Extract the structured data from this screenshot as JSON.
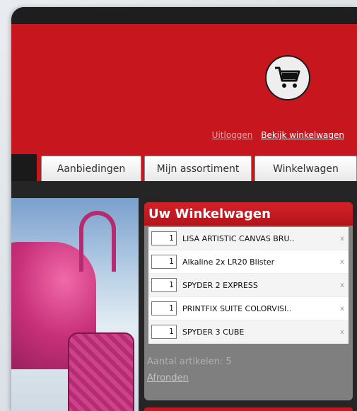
{
  "header": {
    "cart_icon": "shopping-cart-icon",
    "logout_label": "Uitloggen",
    "view_cart_label": "Bekijk winkelwagen"
  },
  "nav": {
    "tabs": [
      {
        "label": "Aanbiedingen"
      },
      {
        "label": "Mijn assortiment"
      },
      {
        "label": "Winkelwagen"
      }
    ]
  },
  "cart": {
    "title": "Uw Winkelwagen",
    "items": [
      {
        "qty": "1",
        "name": "LISA ARTISTIC CANVAS BRU..",
        "remove": "x"
      },
      {
        "qty": "1",
        "name": "Alkaline 2x LR20 Blister",
        "remove": "x"
      },
      {
        "qty": "1",
        "name": "SPYDER 2 EXPRESS",
        "remove": "x"
      },
      {
        "qty": "1",
        "name": "PRINTFIX SUITE COLORVISI..",
        "remove": "x"
      },
      {
        "qty": "1",
        "name": "SPYDER 3 CUBE",
        "remove": "x"
      }
    ],
    "count_label": "Aantal artikelen: 5",
    "finish_label": "Afronden"
  },
  "colors": {
    "brand_red": "#c8161e",
    "panel_gray": "#7f7f7f"
  }
}
